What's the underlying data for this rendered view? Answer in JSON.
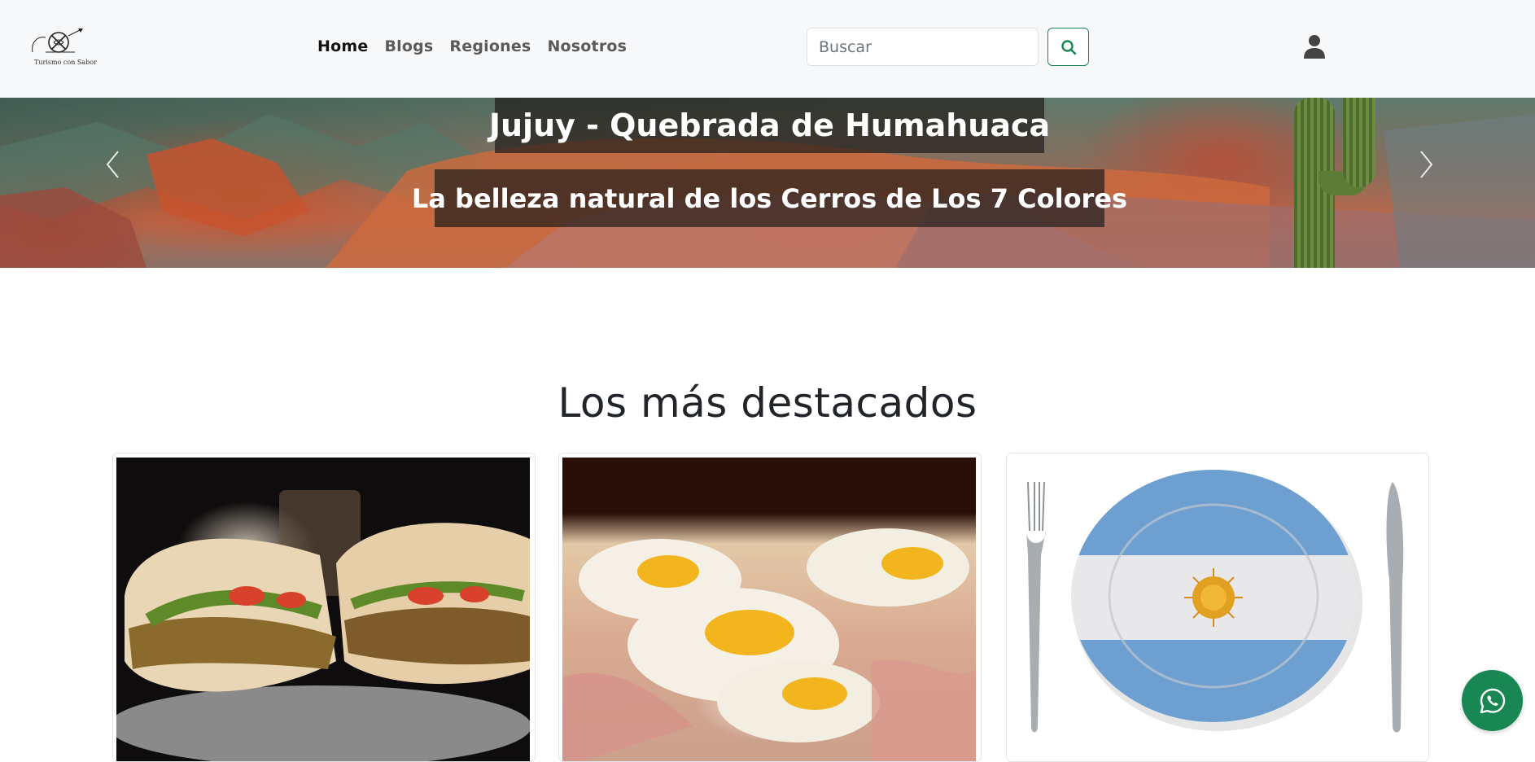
{
  "brand": {
    "logo_text": "Turismo con Sabor"
  },
  "nav": {
    "items": [
      {
        "label": "Home",
        "active": true
      },
      {
        "label": "Blogs",
        "active": false
      },
      {
        "label": "Regiones",
        "active": false
      },
      {
        "label": "Nosotros",
        "active": false
      }
    ]
  },
  "search": {
    "placeholder": "Buscar",
    "value": "",
    "button_icon": "search-icon"
  },
  "user": {
    "icon": "user-icon"
  },
  "hero": {
    "title": "Jujuy - Quebrada de Humahuaca",
    "subtitle": "La belleza natural de los Cerros de Los 7 Colores",
    "prev_icon": "chevron-left-icon",
    "next_icon": "chevron-right-icon"
  },
  "featured": {
    "title": "Los más destacados",
    "cards": [
      {
        "image": "sandwich-de-milanesa"
      },
      {
        "image": "pizza-con-huevos"
      },
      {
        "image": "plato-bandera-argentina"
      }
    ]
  },
  "whatsapp": {
    "icon": "whatsapp-icon",
    "color": "#198754"
  },
  "colors": {
    "navbar_bg": "#f7f8fa",
    "accent": "#198754"
  }
}
